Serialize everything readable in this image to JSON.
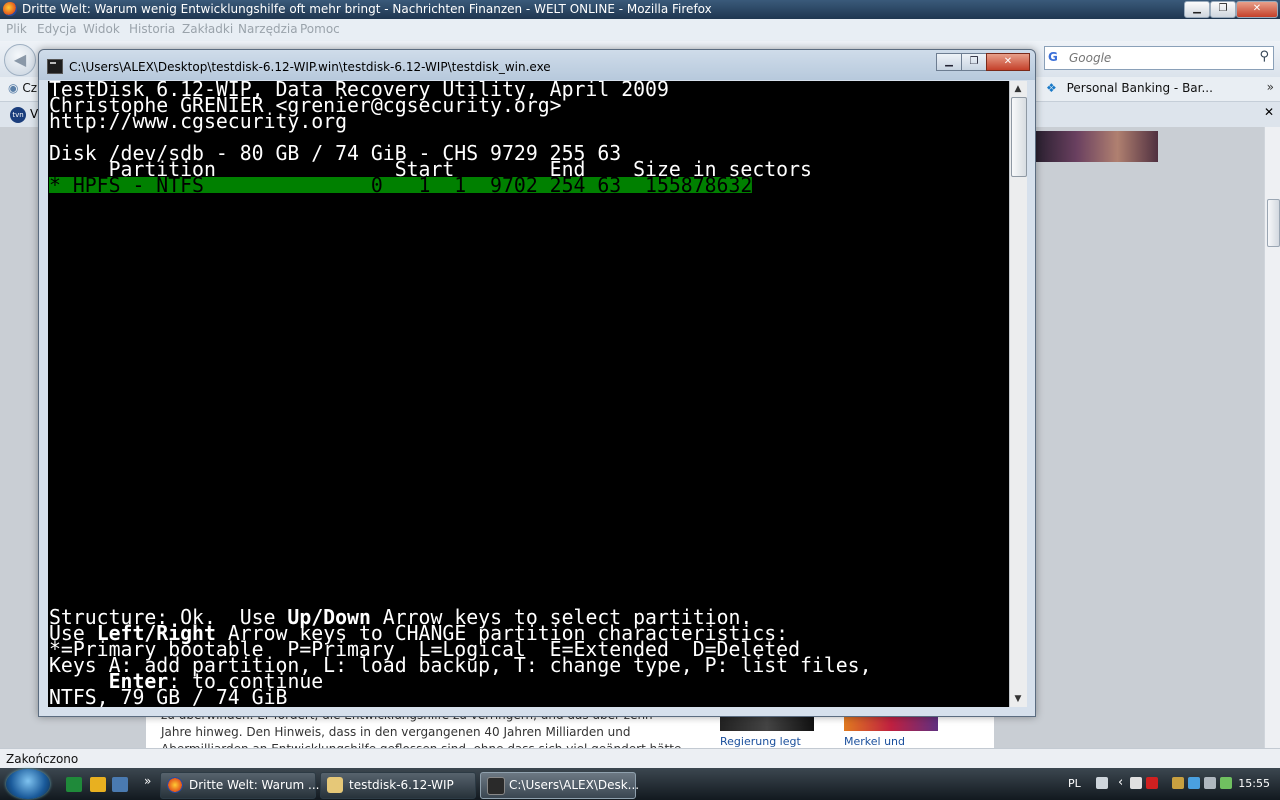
{
  "firefox": {
    "title": "Dritte Welt: Warum wenig Entwicklungshilfe oft mehr bringt - Nachrichten Finanzen - WELT ONLINE - Mozilla Firefox",
    "menu": [
      "Plik",
      "Edycja",
      "Widok",
      "Historia",
      "Zakładki",
      "Narzędzia",
      "Pomoc"
    ],
    "search_placeholder": "Google",
    "bookmarks": {
      "left": "Cz",
      "right": "Personal Banking - Bar...",
      "chevron": "»"
    },
    "tab_short": "V",
    "status": "Zakończono",
    "page": {
      "line1": "zu überwinden. Er fordert, die Entwicklungshilfe zu verringern, und das über zehn",
      "line2": "Jahre hinweg. Den Hinweis, dass in den vergangenen 40 Jahren Milliarden und",
      "line3": "Abermilliarden an Entwicklungshilfe geflossen sind, ohne dass sich viel geändert hätte",
      "link1": "Regierung legt",
      "link2": "Merkel und"
    }
  },
  "console": {
    "title": "C:\\Users\\ALEX\\Desktop\\testdisk-6.12-WIP.win\\testdisk-6.12-WIP\\testdisk_win.exe",
    "lines": {
      "l1": "TestDisk 6.12-WIP, Data Recovery Utility, April 2009",
      "l2": "Christophe GRENIER <grenier@cgsecurity.org>",
      "l3": "http://www.cgsecurity.org",
      "l4": "Disk /dev/sdb - 80 GB / 74 GiB - CHS 9729 255 63",
      "l5": "     Partition               Start        End    Size in sectors",
      "l6": "* HPFS - NTFS              0   1  1  9702 254 63  155878632",
      "s1a": "Structure: Ok.  Use ",
      "s1b": "Up/Down",
      "s1c": " Arrow keys to select partition.",
      "s2a": "Use ",
      "s2b": "Left/Right",
      "s2c": " Arrow keys to CHANGE partition characteristics:",
      "s3": "*=Primary bootable  P=Primary  L=Logical  E=Extended  D=Deleted",
      "s4": "Keys A: add partition, L: load backup, T: change type, P: list files,",
      "s5a": "     ",
      "s5b": "Enter",
      "s5c": ": to continue",
      "s6": "NTFS, 79 GB / 74 GiB"
    }
  },
  "taskbar": {
    "tasks": [
      "Dritte Welt: Warum ...",
      "testdisk-6.12-WIP",
      "C:\\Users\\ALEX\\Desk..."
    ],
    "quicklaunch_more": "»",
    "lang": "PL",
    "time": "15:55",
    "tray_chevron": "‹"
  }
}
